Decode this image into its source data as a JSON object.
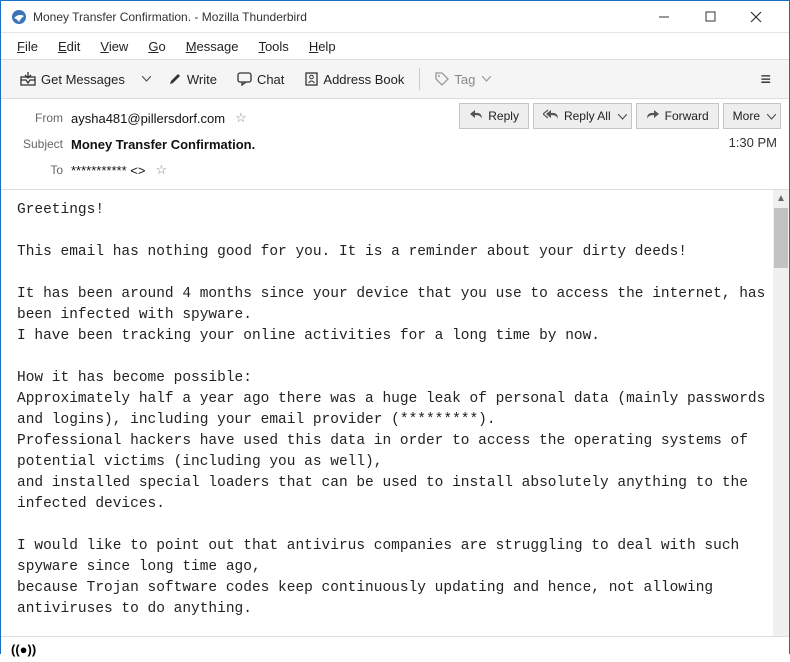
{
  "window": {
    "title": "Money Transfer Confirmation. - Mozilla Thunderbird"
  },
  "menubar": {
    "file": "File",
    "edit": "Edit",
    "view": "View",
    "go": "Go",
    "message": "Message",
    "tools": "Tools",
    "help": "Help"
  },
  "toolbar": {
    "get_messages": "Get Messages",
    "write": "Write",
    "chat": "Chat",
    "address_book": "Address Book",
    "tag": "Tag"
  },
  "actions": {
    "reply": "Reply",
    "reply_all": "Reply All",
    "forward": "Forward",
    "more": "More"
  },
  "headers": {
    "from_label": "From",
    "from_value": "aysha481@pillersdorf.com",
    "subject_label": "Subject",
    "subject_value": "Money Transfer Confirmation.",
    "to_label": "To",
    "to_value": "*********** <>",
    "time": "1:30 PM"
  },
  "body": {
    "text": "Greetings!\n\nThis email has nothing good for you. It is a reminder about your dirty deeds!\n\nIt has been around 4 months since your device that you use to access the internet, has been infected with spyware.\nI have been tracking your online activities for a long time by now.\n\nHow it has become possible:\nApproximately half a year ago there was a huge leak of personal data (mainly passwords and logins), including your email provider (*********).\nProfessional hackers have used this data in order to access the operating systems of potential victims (including you as well),\nand installed special loaders that can be used to install absolutely anything to the infected devices.\n\nI would like to point out that antivirus companies are struggling to deal with such spyware since long time ago,\nbecause Trojan software codes keep continuously updating and hence, not allowing antiviruses to do anything."
  }
}
